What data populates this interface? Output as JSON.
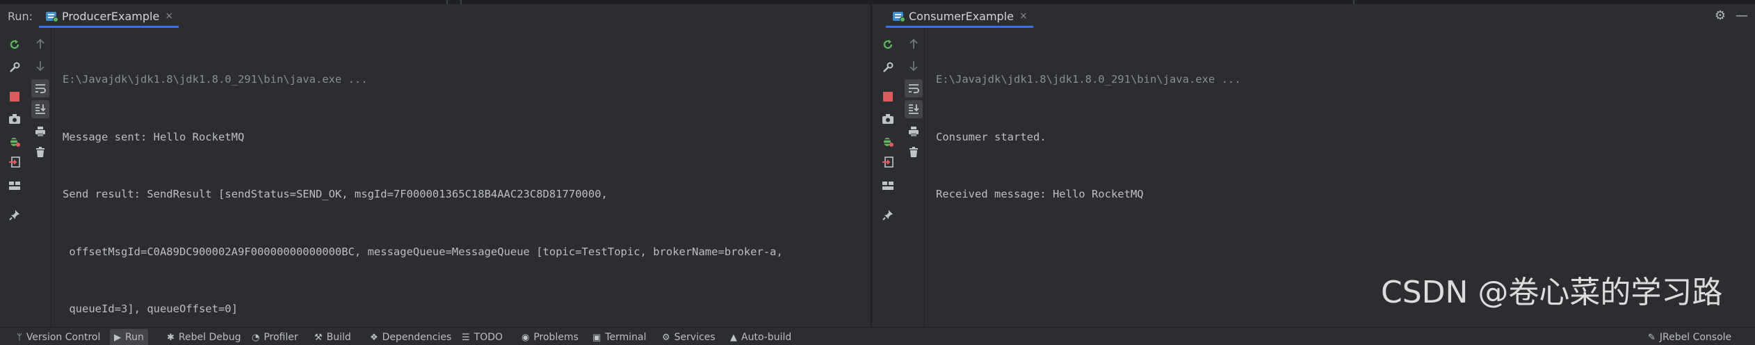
{
  "run_label": "Run:",
  "left_panel": {
    "tab_label": "ProducerExample",
    "close_glyph": "×",
    "console_lines": [
      "E:\\Javajdk\\jdk1.8\\jdk1.8.0_291\\bin\\java.exe ...",
      "Message sent: Hello RocketMQ",
      "Send result: SendResult [sendStatus=SEND_OK, msgId=7F000001365C18B4AAC23C8D81770000,",
      " offsetMsgId=C0A89DC900002A9F00000000000000BC, messageQueue=MessageQueue [topic=TestTopic, brokerName=broker-a,",
      " queueId=3], queueOffset=0]"
    ]
  },
  "right_panel": {
    "tab_label": "ConsumerExample",
    "close_glyph": "×",
    "console_lines": [
      "E:\\Javajdk\\jdk1.8\\jdk1.8.0_291\\bin\\java.exe ...",
      "Consumer started.",
      "Received message: Hello RocketMQ"
    ]
  },
  "header_icons": [
    "settings-icon",
    "minimize-icon"
  ],
  "header_glyphs": {
    "settings": "⚙",
    "minimize": "—"
  },
  "toolbar_icons": [
    "rerun-icon",
    "wrench-icon",
    "stop-icon",
    "camera-icon",
    "debug-bug-icon",
    "exit-icon",
    "layout-icon",
    "pin-icon"
  ],
  "toolbar2_icons": [
    "up-arrow-icon",
    "down-arrow-icon",
    "soft-wrap-icon",
    "scroll-to-end-icon",
    "print-icon",
    "trash-icon"
  ],
  "bottom_tabs": [
    {
      "label": "Version Control",
      "icon": "version-control-icon",
      "glyph": "ᛘ"
    },
    {
      "label": "Run",
      "icon": "play-icon",
      "glyph": "▶"
    },
    {
      "label": "Rebel Debug",
      "icon": "rebel-icon",
      "glyph": "✱"
    },
    {
      "label": "Profiler",
      "icon": "profiler-icon",
      "glyph": "◔"
    },
    {
      "label": "Build",
      "icon": "hammer-icon",
      "glyph": "⚒"
    },
    {
      "label": "Dependencies",
      "icon": "dependencies-icon",
      "glyph": "❖"
    },
    {
      "label": "TODO",
      "icon": "list-icon",
      "glyph": "☰"
    },
    {
      "label": "Problems",
      "icon": "problems-icon",
      "glyph": "◉"
    },
    {
      "label": "Terminal",
      "icon": "terminal-icon",
      "glyph": "▣"
    },
    {
      "label": "Services",
      "icon": "services-icon",
      "glyph": "⚙"
    },
    {
      "label": "Auto-build",
      "icon": "warning-icon",
      "glyph": "▲"
    }
  ],
  "bottom_right": {
    "label": "JRebel Console",
    "icon": "jrebel-icon",
    "glyph": "✎"
  },
  "watermark": "CSDN @卷心菜的学习路"
}
